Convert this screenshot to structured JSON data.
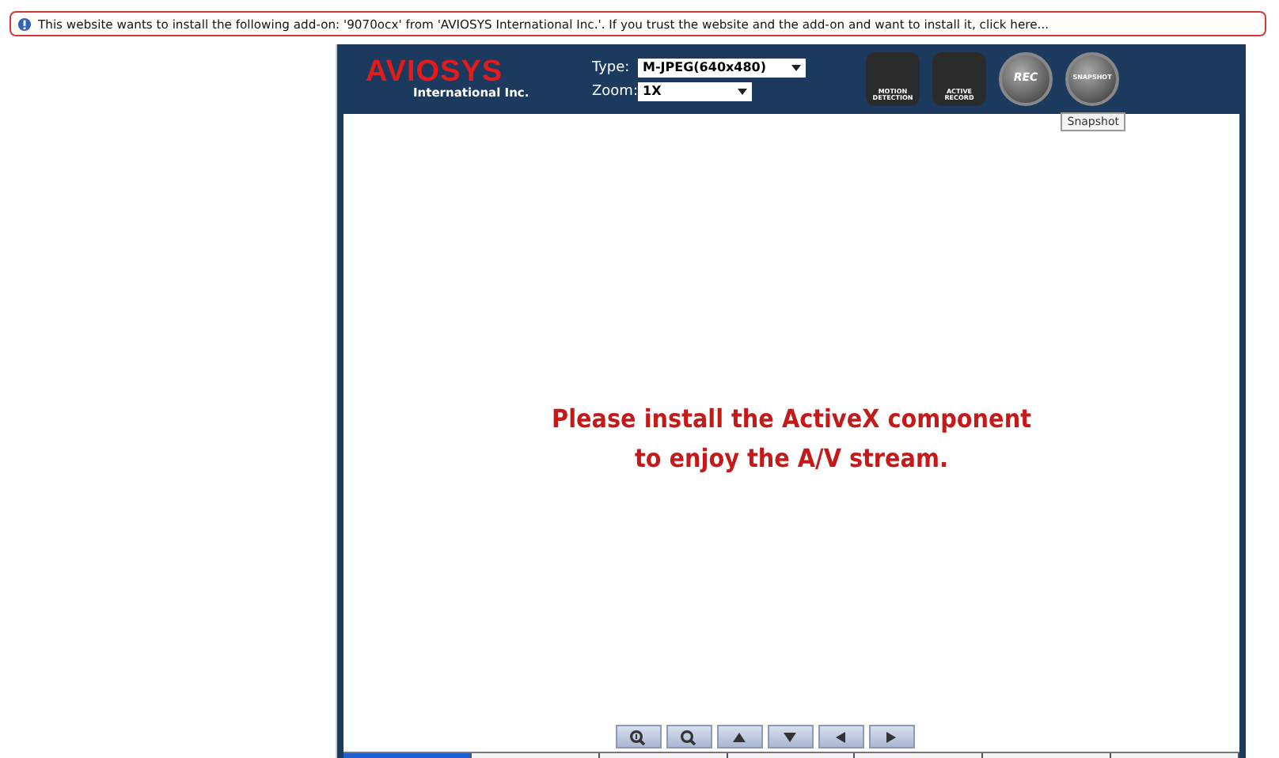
{
  "info_bar": {
    "text": "This website wants to install the following add-on: '9070ocx' from 'AVIOSYS International Inc.'. If you trust the website and the add-on and want to install it, click here..."
  },
  "logo": {
    "brand": "AVIOSYS",
    "subtitle": "International Inc."
  },
  "type_select": {
    "label": "Type:",
    "value": "M-JPEG(640x480)"
  },
  "zoom_select": {
    "label": "Zoom:",
    "value": "1X"
  },
  "tool_buttons": [
    {
      "kind": "square",
      "caption": "MOTION DETECTION"
    },
    {
      "kind": "square",
      "caption": "ACTIVE RECORD"
    },
    {
      "kind": "round",
      "caption": "REC"
    },
    {
      "kind": "round",
      "caption": "SNAPSHOT"
    }
  ],
  "tooltip": "Snapshot",
  "message": [
    "Please install the ActiveX component",
    "to enjoy the A/V stream."
  ],
  "nav_buttons": [
    {
      "kind": "zoom-in"
    },
    {
      "kind": "zoom-out"
    },
    {
      "kind": "up"
    },
    {
      "kind": "down"
    },
    {
      "kind": "left"
    },
    {
      "kind": "right"
    }
  ],
  "bottom_tabs": [
    {
      "selected": true
    },
    {
      "selected": false
    },
    {
      "selected": false
    },
    {
      "selected": false
    },
    {
      "selected": false
    },
    {
      "selected": false
    },
    {
      "selected": false
    }
  ]
}
